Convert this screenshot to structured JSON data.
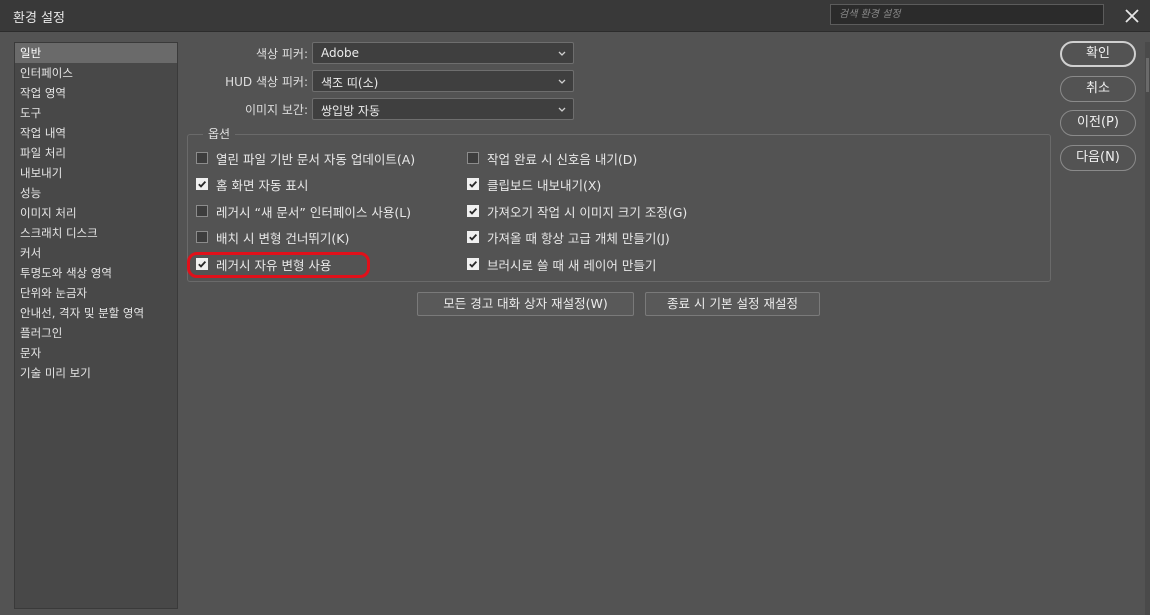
{
  "window": {
    "title": "환경 설정",
    "search_placeholder": "검색 환경 설정"
  },
  "sidebar": {
    "items": [
      {
        "label": "일반",
        "active": true
      },
      {
        "label": "인터페이스"
      },
      {
        "label": "작업 영역"
      },
      {
        "label": "도구"
      },
      {
        "label": "작업 내역"
      },
      {
        "label": "파일 처리"
      },
      {
        "label": "내보내기"
      },
      {
        "label": "성능"
      },
      {
        "label": "이미지 처리"
      },
      {
        "label": "스크래치 디스크"
      },
      {
        "label": "커서"
      },
      {
        "label": "투명도와 색상 영역"
      },
      {
        "label": "단위와 눈금자"
      },
      {
        "label": "안내선, 격자 및 분할 영역"
      },
      {
        "label": "플러그인"
      },
      {
        "label": "문자"
      },
      {
        "label": "기술 미리 보기"
      }
    ]
  },
  "fields": {
    "color_picker": {
      "label": "색상 피커:",
      "value": "Adobe"
    },
    "hud_color_picker": {
      "label": "HUD 색상 피커:",
      "value": "색조 띠(소)"
    },
    "image_interpolation": {
      "label": "이미지 보간:",
      "value": "쌍입방 자동"
    }
  },
  "options": {
    "group_label": "옵션",
    "left": [
      {
        "label": "열린 파일 기반 문서 자동 업데이트(A)",
        "checked": false
      },
      {
        "label": "홈 화면 자동 표시",
        "checked": true
      },
      {
        "label": "레거시 “새 문서” 인터페이스 사용(L)",
        "checked": false
      },
      {
        "label": "배치 시 변형 건너뛰기(K)",
        "checked": false
      },
      {
        "label": "레거시 자유 변형 사용",
        "checked": true
      }
    ],
    "right": [
      {
        "label": "작업 완료 시 신호음 내기(D)",
        "checked": false
      },
      {
        "label": "클립보드 내보내기(X)",
        "checked": true
      },
      {
        "label": "가져오기 작업 시 이미지 크기 조정(G)",
        "checked": true
      },
      {
        "label": "가져올 때 항상 고급 개체 만들기(J)",
        "checked": true
      },
      {
        "label": "브러시로 쓸 때 새 레이어 만들기",
        "checked": true
      }
    ]
  },
  "buttons": {
    "reset_warnings": "모든 경고 대화 상자 재설정(W)",
    "reset_on_quit": "종료 시 기본 설정 재설정",
    "ok": "확인",
    "cancel": "취소",
    "prev": "이전(P)",
    "next": "다음(N)"
  },
  "colors": {
    "background": "#535353",
    "titlebar": "#393939",
    "highlight_ring": "#e0101a"
  },
  "icons": {
    "close": "close-icon",
    "dropdown": "chevron-down-icon",
    "checkbox": "checkmark-icon"
  }
}
